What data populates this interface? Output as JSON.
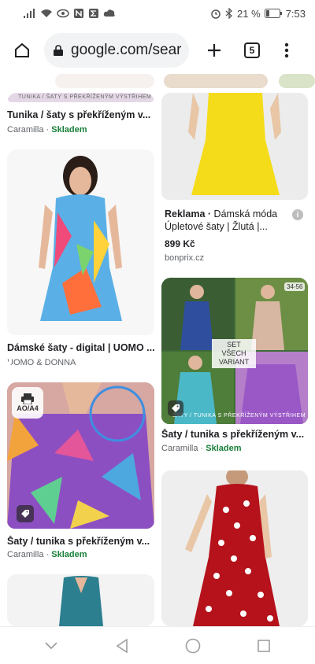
{
  "status_bar": {
    "battery": "21 %",
    "time": "7:53",
    "icons": [
      "signal-icon",
      "wifi-icon",
      "eye-icon",
      "nfc-icon",
      "sigma-icon",
      "cloud-icon",
      "alarm-icon",
      "bluetooth-icon",
      "battery-icon"
    ]
  },
  "toolbar": {
    "url": "google.com/search",
    "tab_count": "5",
    "icons": [
      "home-icon",
      "lock-icon",
      "plus-icon",
      "tabs-icon",
      "more-vert-icon"
    ]
  },
  "results": [
    {
      "title": "Tunika / šaty s překříženým v...",
      "source": "Caramilla",
      "stock": "Skladem",
      "image_overlay": "TUNIKA / ŠATY S PŘEKŘÍŽENÝM VÝSTŘIHEM"
    },
    {
      "ad_label": "Reklama",
      "title": "Dámská móda Úpletové šaty | Žlutá |...",
      "price": "899 Kč",
      "source": "bonprix.cz",
      "info": "i"
    },
    {
      "title": "Dámské šaty - digital | UOMO ...",
      "source": "UOMO & DONNA"
    },
    {
      "title": "Šaty / tunika s překříženým v...",
      "source": "Caramilla",
      "stock": "Skladem",
      "size_label": "34-56",
      "set_label": "SET VŠECH VARIANT",
      "image_overlay": "ŠATY / TUNIKA S PŘEKŘÍŽENÝM VÝSTŘIHEM"
    },
    {
      "title": "Šaty / tunika s překříženým v...",
      "source": "Caramilla",
      "stock": "Skladem",
      "badge": "AO/A4"
    },
    {
      "title": "",
      "source": ""
    },
    {
      "title": "",
      "source": ""
    }
  ],
  "nav_bar": {
    "icons": [
      "chevron-down-icon",
      "back-icon",
      "home-circle-icon",
      "recents-icon"
    ]
  },
  "colors": {
    "stock_green": "#188038",
    "yellow_dress": "#f5dc1a",
    "red_dress": "#b5121b"
  }
}
